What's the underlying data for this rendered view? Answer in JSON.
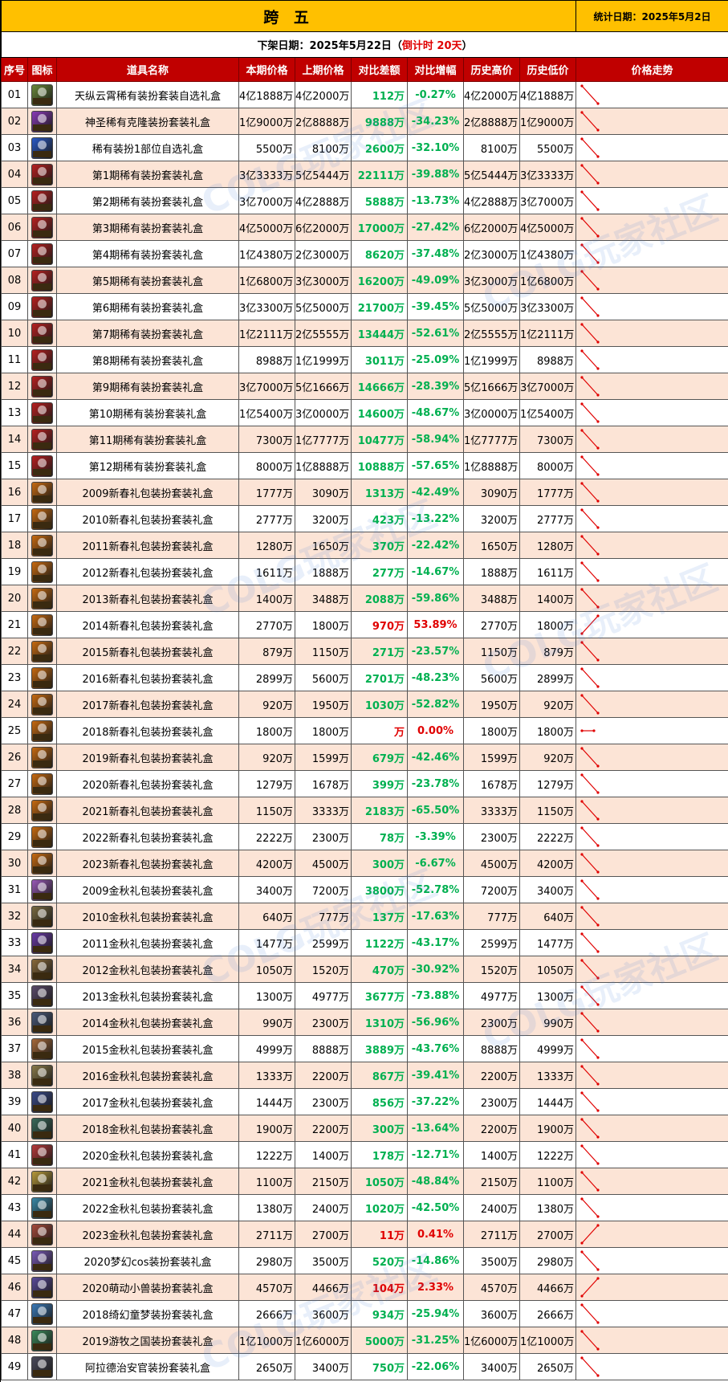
{
  "header": {
    "title": "跨 五",
    "stat_date": "统计日期：2025年5月2日",
    "offline_prefix": "下架日期：2025年5月22日（",
    "offline_countdown": "倒计时 20天",
    "offline_suffix": "）"
  },
  "columns": [
    "序号",
    "图标",
    "道具名称",
    "本期价格",
    "上期价格",
    "对比差额",
    "对比增幅",
    "历史高价",
    "历史低价",
    "价格走势"
  ],
  "colors": {
    "title_bg": "#ffc000",
    "header_bg": "#c00000",
    "even_row_bg": "#fce4d6",
    "decrease": "#00b050",
    "increase": "#e00000"
  },
  "watermark": "COLG玩家社区",
  "rows": [
    {
      "no": "01",
      "name": "天纵云霄稀有装扮套装自选礼盒",
      "cur": "4亿1888万",
      "prev": "4亿2000万",
      "diff": "112万",
      "pct": "-0.27%",
      "hi": "4亿2000万",
      "lo": "4亿1888万",
      "trend": "down",
      "icon_color": "#6a8a3a"
    },
    {
      "no": "02",
      "name": "神圣稀有克隆装扮套装礼盒",
      "cur": "1亿9000万",
      "prev": "2亿8888万",
      "diff": "9888万",
      "pct": "-34.23%",
      "hi": "2亿8888万",
      "lo": "1亿9000万",
      "trend": "down",
      "icon_color": "#8a3ab8"
    },
    {
      "no": "03",
      "name": "稀有装扮1部位自选礼盒",
      "cur": "5500万",
      "prev": "8100万",
      "diff": "2600万",
      "pct": "-32.10%",
      "hi": "8100万",
      "lo": "5500万",
      "trend": "down",
      "icon_color": "#2a5ac8"
    },
    {
      "no": "04",
      "name": "第1期稀有装扮套装礼盒",
      "cur": "3亿3333万",
      "prev": "5亿5444万",
      "diff": "22111万",
      "pct": "-39.88%",
      "hi": "5亿5444万",
      "lo": "3亿3333万",
      "trend": "down",
      "icon_color": "#b82020"
    },
    {
      "no": "05",
      "name": "第2期稀有装扮套装礼盒",
      "cur": "3亿7000万",
      "prev": "4亿2888万",
      "diff": "5888万",
      "pct": "-13.73%",
      "hi": "4亿2888万",
      "lo": "3亿7000万",
      "trend": "down",
      "icon_color": "#b82020"
    },
    {
      "no": "06",
      "name": "第3期稀有装扮套装礼盒",
      "cur": "4亿5000万",
      "prev": "6亿2000万",
      "diff": "17000万",
      "pct": "-27.42%",
      "hi": "6亿2000万",
      "lo": "4亿5000万",
      "trend": "down",
      "icon_color": "#b82020"
    },
    {
      "no": "07",
      "name": "第4期稀有装扮套装礼盒",
      "cur": "1亿4380万",
      "prev": "2亿3000万",
      "diff": "8620万",
      "pct": "-37.48%",
      "hi": "2亿3000万",
      "lo": "1亿4380万",
      "trend": "down",
      "icon_color": "#b82020"
    },
    {
      "no": "08",
      "name": "第5期稀有装扮套装礼盒",
      "cur": "1亿6800万",
      "prev": "3亿3000万",
      "diff": "16200万",
      "pct": "-49.09%",
      "hi": "3亿3000万",
      "lo": "1亿6800万",
      "trend": "down",
      "icon_color": "#b82020"
    },
    {
      "no": "09",
      "name": "第6期稀有装扮套装礼盒",
      "cur": "3亿3300万",
      "prev": "5亿5000万",
      "diff": "21700万",
      "pct": "-39.45%",
      "hi": "5亿5000万",
      "lo": "3亿3300万",
      "trend": "down",
      "icon_color": "#b82020"
    },
    {
      "no": "10",
      "name": "第7期稀有装扮套装礼盒",
      "cur": "1亿2111万",
      "prev": "2亿5555万",
      "diff": "13444万",
      "pct": "-52.61%",
      "hi": "2亿5555万",
      "lo": "1亿2111万",
      "trend": "down",
      "icon_color": "#b82020"
    },
    {
      "no": "11",
      "name": "第8期稀有装扮套装礼盒",
      "cur": "8988万",
      "prev": "1亿1999万",
      "diff": "3011万",
      "pct": "-25.09%",
      "hi": "1亿1999万",
      "lo": "8988万",
      "trend": "down",
      "icon_color": "#b82020"
    },
    {
      "no": "12",
      "name": "第9期稀有装扮套装礼盒",
      "cur": "3亿7000万",
      "prev": "5亿1666万",
      "diff": "14666万",
      "pct": "-28.39%",
      "hi": "5亿1666万",
      "lo": "3亿7000万",
      "trend": "down",
      "icon_color": "#b82020"
    },
    {
      "no": "13",
      "name": "第10期稀有装扮套装礼盒",
      "cur": "1亿5400万",
      "prev": "3亿0000万",
      "diff": "14600万",
      "pct": "-48.67%",
      "hi": "3亿0000万",
      "lo": "1亿5400万",
      "trend": "down",
      "icon_color": "#b82020"
    },
    {
      "no": "14",
      "name": "第11期稀有装扮套装礼盒",
      "cur": "7300万",
      "prev": "1亿7777万",
      "diff": "10477万",
      "pct": "-58.94%",
      "hi": "1亿7777万",
      "lo": "7300万",
      "trend": "down",
      "icon_color": "#b82020"
    },
    {
      "no": "15",
      "name": "第12期稀有装扮套装礼盒",
      "cur": "8000万",
      "prev": "1亿8888万",
      "diff": "10888万",
      "pct": "-57.65%",
      "hi": "1亿8888万",
      "lo": "8000万",
      "trend": "down",
      "icon_color": "#b82020"
    },
    {
      "no": "16",
      "name": "2009新春礼包装扮套装礼盒",
      "cur": "1777万",
      "prev": "3090万",
      "diff": "1313万",
      "pct": "-42.49%",
      "hi": "3090万",
      "lo": "1777万",
      "trend": "down",
      "icon_color": "#c86a10"
    },
    {
      "no": "17",
      "name": "2010新春礼包装扮套装礼盒",
      "cur": "2777万",
      "prev": "3200万",
      "diff": "423万",
      "pct": "-13.22%",
      "hi": "3200万",
      "lo": "2777万",
      "trend": "down",
      "icon_color": "#c86a10"
    },
    {
      "no": "18",
      "name": "2011新春礼包装扮套装礼盒",
      "cur": "1280万",
      "prev": "1650万",
      "diff": "370万",
      "pct": "-22.42%",
      "hi": "1650万",
      "lo": "1280万",
      "trend": "down",
      "icon_color": "#c86a10"
    },
    {
      "no": "19",
      "name": "2012新春礼包装扮套装礼盒",
      "cur": "1611万",
      "prev": "1888万",
      "diff": "277万",
      "pct": "-14.67%",
      "hi": "1888万",
      "lo": "1611万",
      "trend": "down",
      "icon_color": "#c86a10"
    },
    {
      "no": "20",
      "name": "2013新春礼包装扮套装礼盒",
      "cur": "1400万",
      "prev": "3488万",
      "diff": "2088万",
      "pct": "-59.86%",
      "hi": "3488万",
      "lo": "1400万",
      "trend": "down",
      "icon_color": "#c86a10"
    },
    {
      "no": "21",
      "name": "2014新春礼包装扮套装礼盒",
      "cur": "2770万",
      "prev": "1800万",
      "diff": "970万",
      "pct": "53.89%",
      "hi": "2770万",
      "lo": "1800万",
      "trend": "up",
      "icon_color": "#c86a10"
    },
    {
      "no": "22",
      "name": "2015新春礼包装扮套装礼盒",
      "cur": "879万",
      "prev": "1150万",
      "diff": "271万",
      "pct": "-23.57%",
      "hi": "1150万",
      "lo": "879万",
      "trend": "down",
      "icon_color": "#c86a10"
    },
    {
      "no": "23",
      "name": "2016新春礼包装扮套装礼盒",
      "cur": "2899万",
      "prev": "5600万",
      "diff": "2701万",
      "pct": "-48.23%",
      "hi": "5600万",
      "lo": "2899万",
      "trend": "down",
      "icon_color": "#c86a10"
    },
    {
      "no": "24",
      "name": "2017新春礼包装扮套装礼盒",
      "cur": "920万",
      "prev": "1950万",
      "diff": "1030万",
      "pct": "-52.82%",
      "hi": "1950万",
      "lo": "920万",
      "trend": "down",
      "icon_color": "#c86a10"
    },
    {
      "no": "25",
      "name": "2018新春礼包装扮套装礼盒",
      "cur": "1800万",
      "prev": "1800万",
      "diff": "万",
      "pct": "0.00%",
      "hi": "1800万",
      "lo": "1800万",
      "trend": "flat",
      "icon_color": "#c86a10"
    },
    {
      "no": "26",
      "name": "2019新春礼包装扮套装礼盒",
      "cur": "920万",
      "prev": "1599万",
      "diff": "679万",
      "pct": "-42.46%",
      "hi": "1599万",
      "lo": "920万",
      "trend": "down",
      "icon_color": "#c86a10"
    },
    {
      "no": "27",
      "name": "2020新春礼包装扮套装礼盒",
      "cur": "1279万",
      "prev": "1678万",
      "diff": "399万",
      "pct": "-23.78%",
      "hi": "1678万",
      "lo": "1279万",
      "trend": "down",
      "icon_color": "#c86a10"
    },
    {
      "no": "28",
      "name": "2021新春礼包装扮套装礼盒",
      "cur": "1150万",
      "prev": "3333万",
      "diff": "2183万",
      "pct": "-65.50%",
      "hi": "3333万",
      "lo": "1150万",
      "trend": "down",
      "icon_color": "#c86a10"
    },
    {
      "no": "29",
      "name": "2022新春礼包装扮套装礼盒",
      "cur": "2222万",
      "prev": "2300万",
      "diff": "78万",
      "pct": "-3.39%",
      "hi": "2300万",
      "lo": "2222万",
      "trend": "down",
      "icon_color": "#c86a10"
    },
    {
      "no": "30",
      "name": "2023新春礼包装扮套装礼盒",
      "cur": "4200万",
      "prev": "4500万",
      "diff": "300万",
      "pct": "-6.67%",
      "hi": "4500万",
      "lo": "4200万",
      "trend": "down",
      "icon_color": "#c86a10"
    },
    {
      "no": "31",
      "name": "2009金秋礼包装扮套装礼盒",
      "cur": "3400万",
      "prev": "7200万",
      "diff": "3800万",
      "pct": "-52.78%",
      "hi": "7200万",
      "lo": "3400万",
      "trend": "down",
      "icon_color": "#9a5ab8"
    },
    {
      "no": "32",
      "name": "2010金秋礼包装扮套装礼盒",
      "cur": "640万",
      "prev": "777万",
      "diff": "137万",
      "pct": "-17.63%",
      "hi": "777万",
      "lo": "640万",
      "trend": "down",
      "icon_color": "#7a6a40"
    },
    {
      "no": "33",
      "name": "2011金秋礼包装扮套装礼盒",
      "cur": "1477万",
      "prev": "2599万",
      "diff": "1122万",
      "pct": "-43.17%",
      "hi": "2599万",
      "lo": "1477万",
      "trend": "down",
      "icon_color": "#6a3aa8"
    },
    {
      "no": "34",
      "name": "2012金秋礼包装扮套装礼盒",
      "cur": "1050万",
      "prev": "1520万",
      "diff": "470万",
      "pct": "-30.92%",
      "hi": "1520万",
      "lo": "1050万",
      "trend": "down",
      "icon_color": "#8a6a3a"
    },
    {
      "no": "35",
      "name": "2013金秋礼包装扮套装礼盒",
      "cur": "1300万",
      "prev": "4977万",
      "diff": "3677万",
      "pct": "-73.88%",
      "hi": "4977万",
      "lo": "1300万",
      "trend": "down",
      "icon_color": "#5a4a6a"
    },
    {
      "no": "36",
      "name": "2014金秋礼包装扮套装礼盒",
      "cur": "990万",
      "prev": "2300万",
      "diff": "1310万",
      "pct": "-56.96%",
      "hi": "2300万",
      "lo": "990万",
      "trend": "down",
      "icon_color": "#4a5a7a"
    },
    {
      "no": "37",
      "name": "2015金秋礼包装扮套装礼盒",
      "cur": "4999万",
      "prev": "8888万",
      "diff": "3889万",
      "pct": "-43.76%",
      "hi": "8888万",
      "lo": "4999万",
      "trend": "down",
      "icon_color": "#a86a3a"
    },
    {
      "no": "38",
      "name": "2016金秋礼包装扮套装礼盒",
      "cur": "1333万",
      "prev": "2200万",
      "diff": "867万",
      "pct": "-39.41%",
      "hi": "2200万",
      "lo": "1333万",
      "trend": "down",
      "icon_color": "#8a7a4a"
    },
    {
      "no": "39",
      "name": "2017金秋礼包装扮套装礼盒",
      "cur": "1444万",
      "prev": "2300万",
      "diff": "856万",
      "pct": "-37.22%",
      "hi": "2300万",
      "lo": "1444万",
      "trend": "down",
      "icon_color": "#3a4a8a"
    },
    {
      "no": "40",
      "name": "2018金秋礼包装扮套装礼盒",
      "cur": "1900万",
      "prev": "2200万",
      "diff": "300万",
      "pct": "-13.64%",
      "hi": "2200万",
      "lo": "1900万",
      "trend": "down",
      "icon_color": "#3a6a5a"
    },
    {
      "no": "41",
      "name": "2020金秋礼包装扮套装礼盒",
      "cur": "1222万",
      "prev": "1400万",
      "diff": "178万",
      "pct": "-12.71%",
      "hi": "1400万",
      "lo": "1222万",
      "trend": "down",
      "icon_color": "#b83a3a"
    },
    {
      "no": "42",
      "name": "2021金秋礼包装扮套装礼盒",
      "cur": "1100万",
      "prev": "2150万",
      "diff": "1050万",
      "pct": "-48.84%",
      "hi": "2150万",
      "lo": "1100万",
      "trend": "down",
      "icon_color": "#b89a3a"
    },
    {
      "no": "43",
      "name": "2022金秋礼包装扮套装礼盒",
      "cur": "1380万",
      "prev": "2400万",
      "diff": "1020万",
      "pct": "-42.50%",
      "hi": "2400万",
      "lo": "1380万",
      "trend": "down",
      "icon_color": "#3a8aa8"
    },
    {
      "no": "44",
      "name": "2023金秋礼包装扮套装礼盒",
      "cur": "2711万",
      "prev": "2700万",
      "diff": "11万",
      "pct": "0.41%",
      "hi": "2711万",
      "lo": "2700万",
      "trend": "up",
      "icon_color": "#a84a3a"
    },
    {
      "no": "45",
      "name": "2020梦幻cos装扮套装礼盒",
      "cur": "2980万",
      "prev": "3500万",
      "diff": "520万",
      "pct": "-14.86%",
      "hi": "3500万",
      "lo": "2980万",
      "trend": "down",
      "icon_color": "#7a5ab8"
    },
    {
      "no": "46",
      "name": "2020萌动小兽装扮套装礼盒",
      "cur": "4570万",
      "prev": "4466万",
      "diff": "104万",
      "pct": "2.33%",
      "hi": "4570万",
      "lo": "4466万",
      "trend": "up",
      "icon_color": "#5a4a9a"
    },
    {
      "no": "47",
      "name": "2018绮幻童梦装扮套装礼盒",
      "cur": "2666万",
      "prev": "3600万",
      "diff": "934万",
      "pct": "-25.94%",
      "hi": "3600万",
      "lo": "2666万",
      "trend": "down",
      "icon_color": "#3a7ab8"
    },
    {
      "no": "48",
      "name": "2019游牧之国装扮套装礼盒",
      "cur": "1亿1000万",
      "prev": "1亿6000万",
      "diff": "5000万",
      "pct": "-31.25%",
      "hi": "1亿6000万",
      "lo": "1亿1000万",
      "trend": "down",
      "icon_color": "#3a8a5a"
    },
    {
      "no": "49",
      "name": "阿拉德治安官装扮套装礼盒",
      "cur": "2650万",
      "prev": "3400万",
      "diff": "750万",
      "pct": "-22.06%",
      "hi": "3400万",
      "lo": "2650万",
      "trend": "down",
      "icon_color": "#4a4a5a"
    }
  ]
}
